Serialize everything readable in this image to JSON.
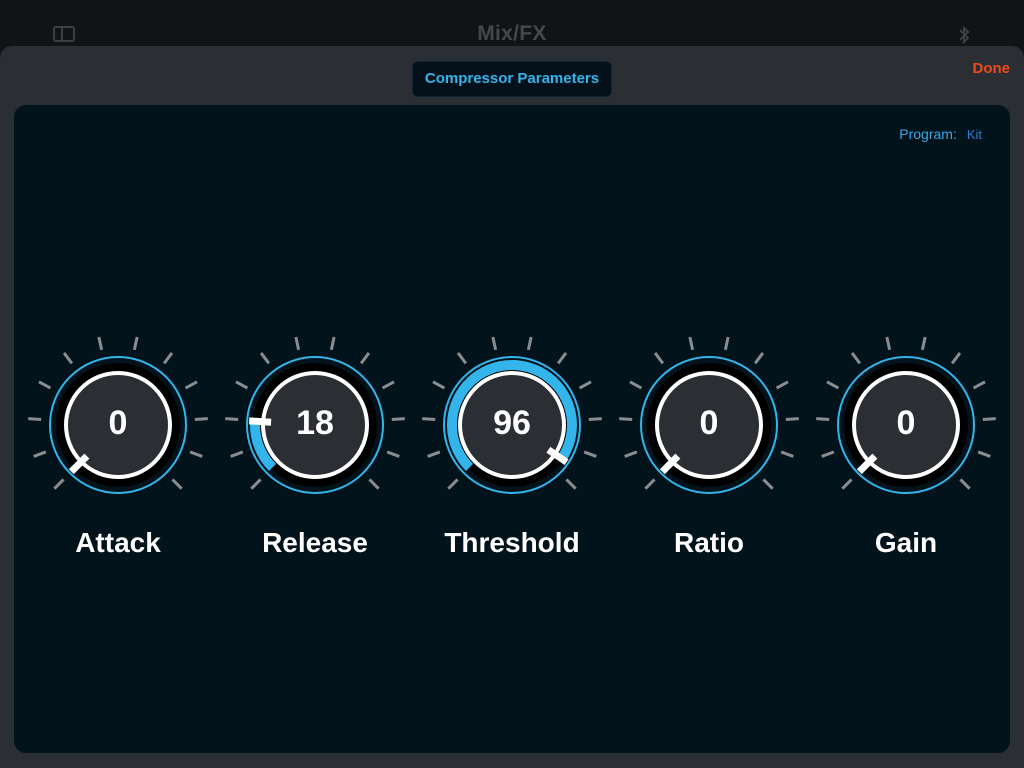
{
  "window": {
    "title": "Mix/FX"
  },
  "sheet": {
    "header": "Compressor Parameters",
    "done_label": "Done",
    "program_label": "Program:",
    "program_value": "Kit"
  },
  "colors": {
    "accent": "#33b4ea",
    "done": "#ef4a1e",
    "knob_fill": "#2b2e32",
    "tick": "#8a8d90"
  },
  "icons": {
    "sidebar": "sidebar-toggle-icon",
    "bluetooth": "bluetooth-icon"
  },
  "knobs": [
    {
      "label": "Attack",
      "value": "0",
      "level": 0.0
    },
    {
      "label": "Release",
      "value": "18",
      "level": 0.18
    },
    {
      "label": "Threshold",
      "value": "96",
      "level": 0.96
    },
    {
      "label": "Ratio",
      "value": "0",
      "level": 0.0
    },
    {
      "label": "Gain",
      "value": "0",
      "level": 0.0
    }
  ]
}
